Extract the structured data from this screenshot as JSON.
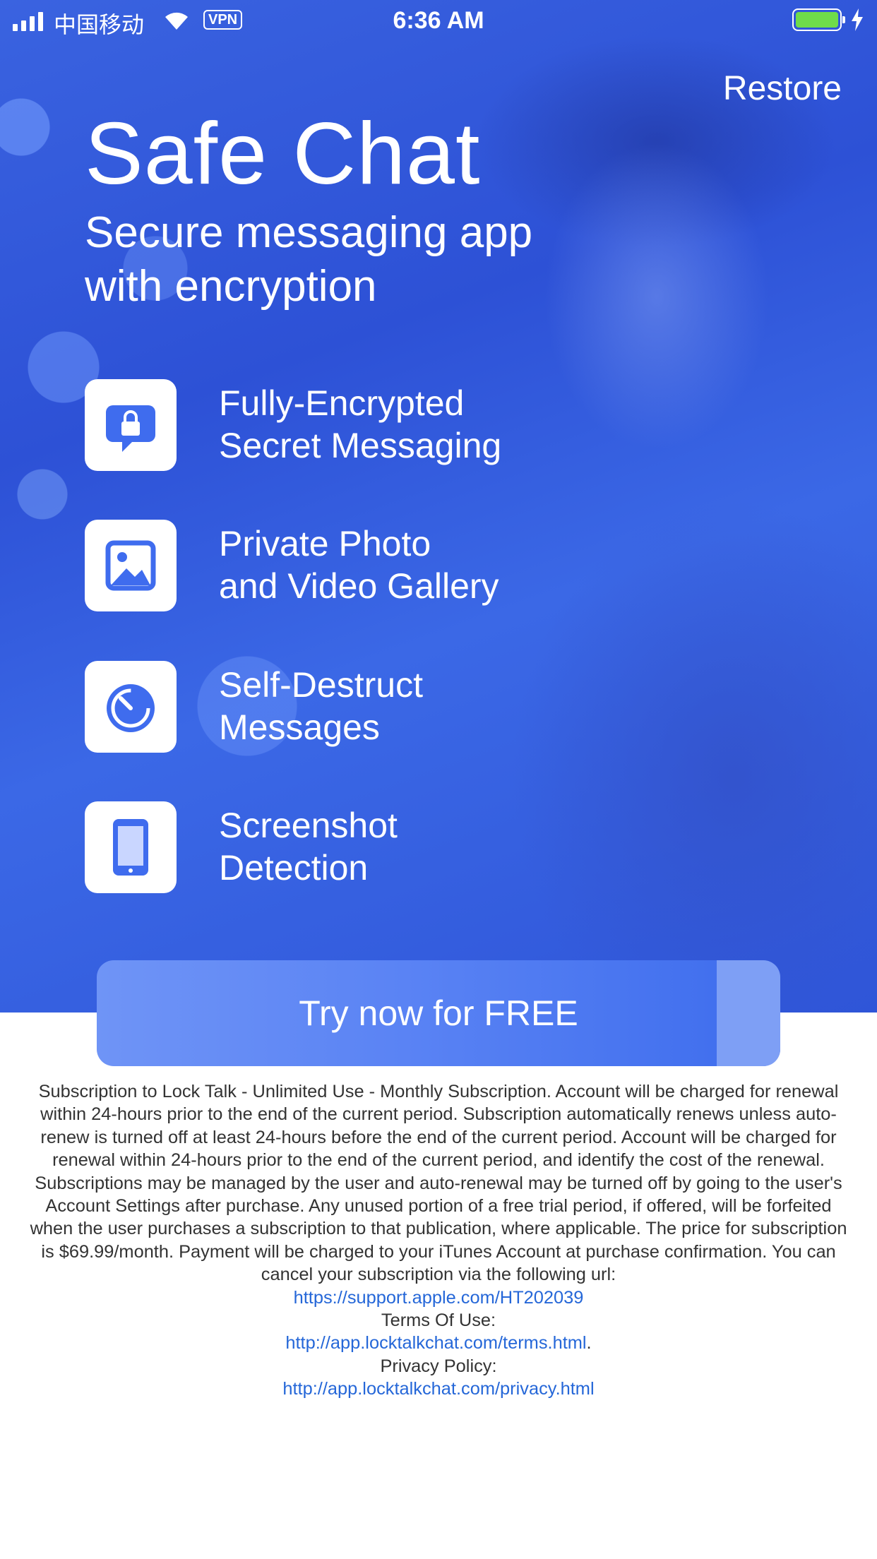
{
  "status_bar": {
    "carrier": "中国移动",
    "vpn": "VPN",
    "time": "6:36 AM"
  },
  "header": {
    "restore": "Restore",
    "title": "Safe Chat",
    "subtitle": "Secure messaging app with encryption"
  },
  "features": [
    {
      "icon": "lock-message-icon",
      "label": "Fully-Encrypted\nSecret Messaging"
    },
    {
      "icon": "photo-gallery-icon",
      "label": "Private Photo\nand Video Gallery"
    },
    {
      "icon": "timer-icon",
      "label": "Self-Destruct\nMessages"
    },
    {
      "icon": "phone-screenshot-icon",
      "label": "Screenshot\nDetection"
    }
  ],
  "cta": {
    "label": "Try now for FREE"
  },
  "legal": {
    "body": "Subscription to Lock Talk - Unlimited Use - Monthly Subscription. Account will be charged for renewal within 24-hours prior to the end of the current period. Subscription automatically renews unless auto-renew is turned off at least 24-hours before the end of the current period. Account will be charged for renewal within 24-hours prior to the end of the current period, and identify the cost of the renewal. Subscriptions may be managed by the user and auto-renewal may be turned off by going to the user's Account Settings after purchase. Any unused portion of a free trial period, if offered, will be forfeited when the user purchases a subscription to that publication, where applicable. The price for subscription is $69.99/month. Payment will be charged to your iTunes Account at purchase confirmation. You can cancel your subscription via the following url:",
    "support_url": "https://support.apple.com/HT202039",
    "terms_label": "Terms Of Use:",
    "terms_url": "http://app.locktalkchat.com/terms.html",
    "terms_suffix": ".",
    "privacy_label": "Privacy Policy:",
    "privacy_url": "http://app.locktalkchat.com/privacy.html"
  },
  "colors": {
    "hero_blue": "#3a63e0",
    "icon_blue": "#3f6cee",
    "link_blue": "#2567d8",
    "battery_green": "#6fdc4a"
  }
}
